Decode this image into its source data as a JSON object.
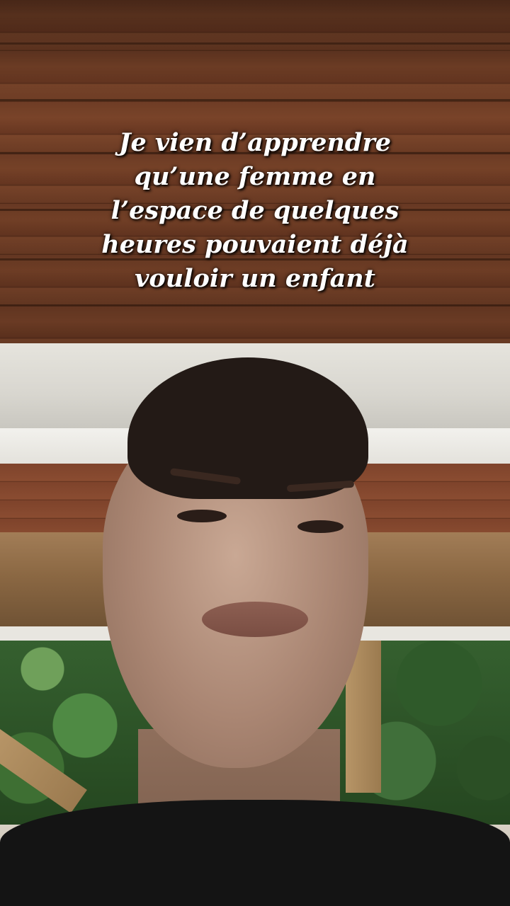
{
  "caption": {
    "lines": [
      "Je vien d’apprendre",
      "qu’une femme en",
      "l’espace de quelques",
      "heures pouvaient déjà",
      "vouloir un enfant"
    ]
  }
}
